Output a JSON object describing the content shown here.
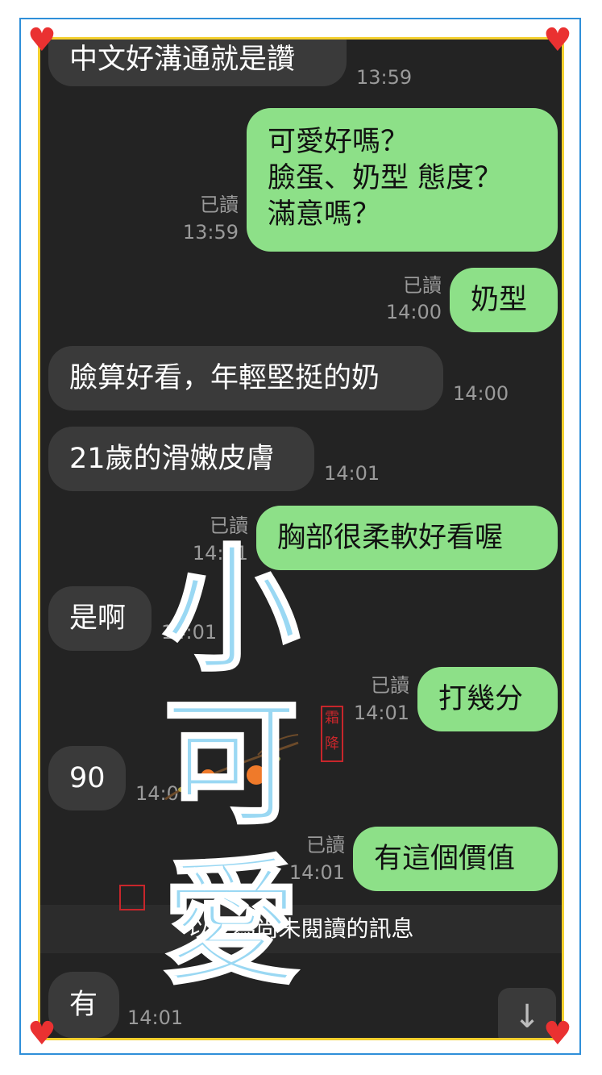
{
  "messages": [
    {
      "dir": "in",
      "text": "中文好溝通就是讚",
      "time": "13:59"
    },
    {
      "dir": "out",
      "text": "可愛好嗎？\n臉蛋、奶型 態度？\n滿意嗎？",
      "status": "已讀",
      "time": "13:59"
    },
    {
      "dir": "out",
      "text": "奶型",
      "status": "已讀",
      "time": "14:00"
    },
    {
      "dir": "in",
      "text": "臉算好看，年輕堅挺的奶",
      "time": "14:00"
    },
    {
      "dir": "in",
      "text": "21歲的滑嫩皮膚",
      "time": "14:01"
    },
    {
      "dir": "out",
      "text": "胸部很柔軟好看喔",
      "status": "已讀",
      "time": "14:01"
    },
    {
      "dir": "in",
      "text": "是啊",
      "time": "14:01"
    },
    {
      "dir": "out",
      "text": "打幾分",
      "status": "已讀",
      "time": "14:01"
    },
    {
      "dir": "in",
      "text": "90",
      "time": "14:01"
    },
    {
      "dir": "out",
      "text": "有這個價值",
      "status": "已讀",
      "time": "14:01"
    },
    {
      "dir": "in",
      "text": "有",
      "time": "14:01"
    }
  ],
  "unread_divider": "以下為尚未閱讀的訊息",
  "overlay_text": [
    "小",
    "可",
    "愛"
  ],
  "seal_text": [
    "霜",
    "降"
  ],
  "icons": {
    "corner": "heart-icon",
    "scroll": "arrow-down-icon"
  },
  "colors": {
    "outgoing": "#8de088",
    "incoming": "#3a3a3a",
    "background": "#232323",
    "frame_outer": "#2f8fd9",
    "frame_inner": "#f3cf2e",
    "heart": "#ea3131",
    "overlay": "#9ad8f3"
  }
}
